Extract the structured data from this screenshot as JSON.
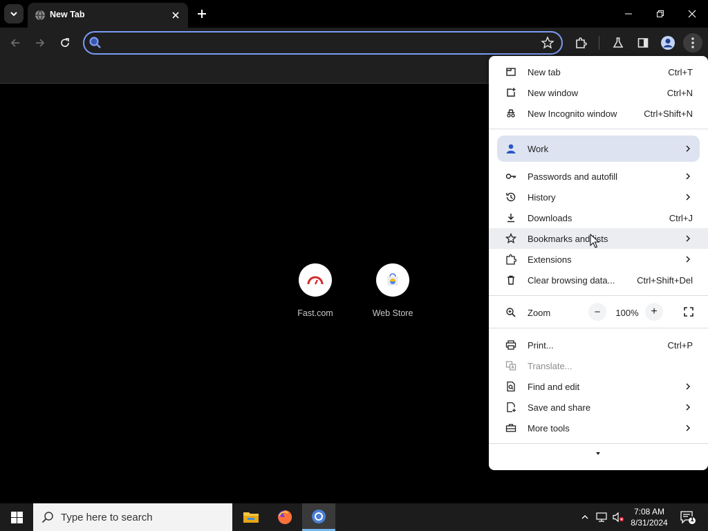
{
  "browser": {
    "tab": {
      "title": "New Tab"
    },
    "omnibox": {
      "value": "",
      "placeholder": ""
    }
  },
  "shortcuts": [
    {
      "label": "Fast.com",
      "icon": "speedometer-icon"
    },
    {
      "label": "Web Store",
      "icon": "web-store-icon"
    }
  ],
  "menu": {
    "new_tab": {
      "label": "New tab",
      "shortcut": "Ctrl+T"
    },
    "new_window": {
      "label": "New window",
      "shortcut": "Ctrl+N"
    },
    "new_incognito": {
      "label": "New Incognito window",
      "shortcut": "Ctrl+Shift+N"
    },
    "profile": {
      "label": "Work"
    },
    "passwords": {
      "label": "Passwords and autofill"
    },
    "history": {
      "label": "History"
    },
    "downloads": {
      "label": "Downloads",
      "shortcut": "Ctrl+J"
    },
    "bookmarks": {
      "label": "Bookmarks and lists"
    },
    "extensions": {
      "label": "Extensions"
    },
    "clear_data": {
      "label": "Clear browsing data...",
      "shortcut": "Ctrl+Shift+Del"
    },
    "zoom": {
      "label": "Zoom",
      "value": "100%",
      "minus": "−",
      "plus": "+"
    },
    "print": {
      "label": "Print...",
      "shortcut": "Ctrl+P"
    },
    "translate": {
      "label": "Translate..."
    },
    "find_edit": {
      "label": "Find and edit"
    },
    "save_share": {
      "label": "Save and share"
    },
    "more_tools": {
      "label": "More tools"
    }
  },
  "taskbar": {
    "search_placeholder": "Type here to search",
    "time": "7:08 AM",
    "date": "8/31/2024",
    "notification_count": "1"
  },
  "colors": {
    "accent": "#7b9cf5",
    "menu_bg": "#ffffff",
    "toolbar_bg": "#1f1f1f",
    "profile_highlight": "#dde3f0",
    "fast_red": "#d12b2b"
  }
}
